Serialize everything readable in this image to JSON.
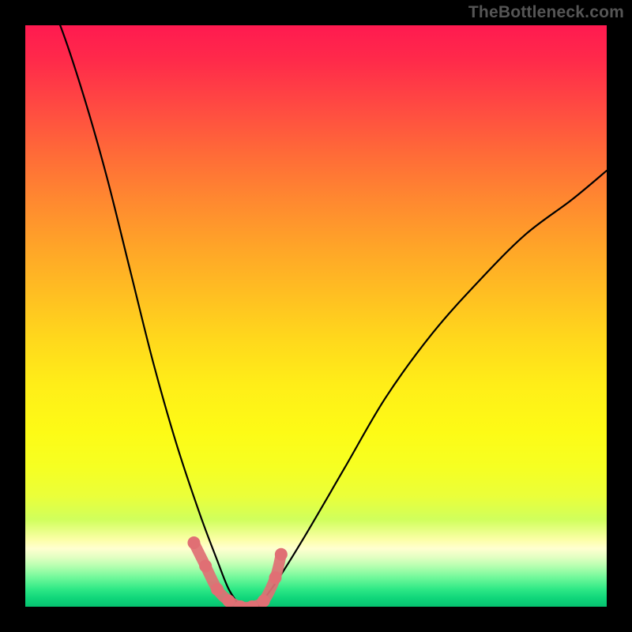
{
  "watermark_text": "TheBottleneck.com",
  "chart_data": {
    "type": "line",
    "title": "",
    "xlabel": "",
    "ylabel": "",
    "x_range": [
      0,
      100
    ],
    "y_range_percent": [
      0,
      100
    ],
    "background_gradient_meaning": "red(top)=high bottleneck, green(bottom)=low bottleneck",
    "series": [
      {
        "name": "bottleneck-left",
        "description": "steep descending curve from top-left to valley",
        "x": [
          6,
          10,
          14,
          18,
          22,
          26,
          30,
          33,
          35,
          37
        ],
        "y_percent": [
          100,
          88,
          74,
          58,
          42,
          28,
          16,
          8,
          3,
          0
        ]
      },
      {
        "name": "bottleneck-right",
        "description": "ascending curve from valley to upper-right",
        "x": [
          40,
          43,
          48,
          55,
          62,
          70,
          78,
          86,
          94,
          100
        ],
        "y_percent": [
          0,
          4,
          12,
          24,
          36,
          47,
          56,
          64,
          70,
          75
        ]
      },
      {
        "name": "optimal-zone-markers",
        "description": "pink segment markers along valley floor",
        "x": [
          29,
          31,
          33,
          35,
          37,
          39,
          41,
          43,
          44
        ],
        "y_percent": [
          11,
          7,
          3,
          1,
          0,
          0,
          1,
          5,
          9
        ]
      }
    ]
  }
}
